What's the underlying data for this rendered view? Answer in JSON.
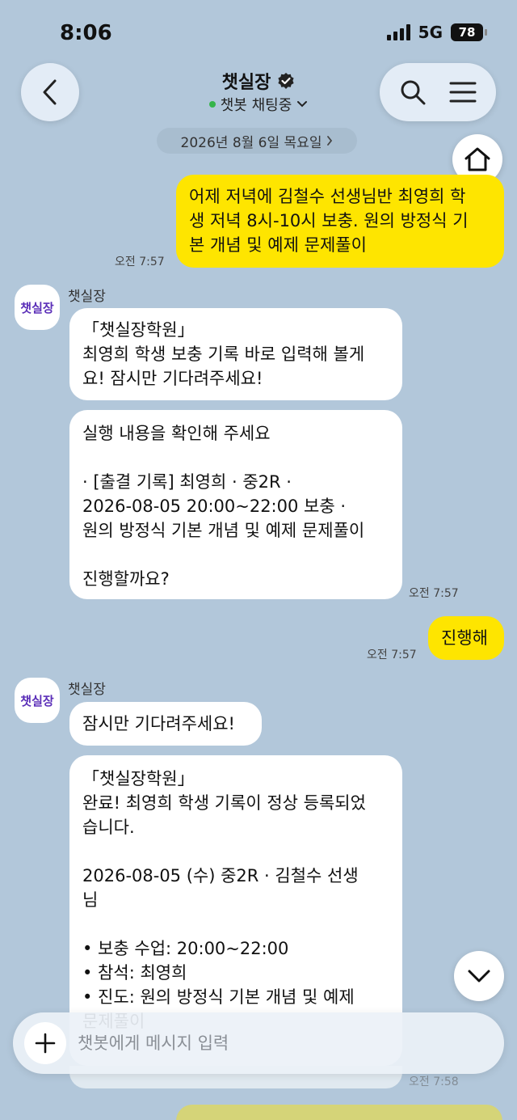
{
  "status": {
    "time": "8:06",
    "network": "5G",
    "battery": "78"
  },
  "header": {
    "title": "챗실장",
    "subtitle": "챗봇 채팅중"
  },
  "date_divider": "2026년 8월 6일 목요일",
  "messages": [
    {
      "from": "user",
      "text": "어제 저녁에 김철수 선생님반 최영희 학\n생 저녁 8시-10시 보충. 원의 방정식 기\n본 개념 및 예제 문제풀이",
      "time": "오전 7:57"
    },
    {
      "from": "bot",
      "sender": "챗실장",
      "avatar": "챗실장",
      "text": "「챗실장학원」\n최영희 학생 보충 기록 바로 입력해 볼게\n요! 잠시만 기다려주세요!"
    },
    {
      "from": "bot",
      "text": "실행 내용을 확인해 주세요\n\n· [출결 기록] 최영희 · 중2R ·\n2026-08-05 20:00~22:00 보충 ·\n원의 방정식 기본 개념 및 예제 문제풀이\n\n진행할까요?",
      "time": "오전 7:57"
    },
    {
      "from": "user",
      "text": "진행해",
      "time": "오전 7:57"
    },
    {
      "from": "bot",
      "sender": "챗실장",
      "avatar": "챗실장",
      "text": "잠시만 기다려주세요!"
    },
    {
      "from": "bot",
      "text": "「챗실장학원」\n완료! 최영희 학생 기록이 정상 등록되었\n습니다.\n\n2026-08-05 (수) 중2R · 김철수 선생\n님\n\n• 보충 수업: 20:00~22:00\n• 참석: 최영희\n• 진도: 원의 방정식 기본 개념 및 예제\n문제풀이",
      "time": "오전 7:58"
    }
  ],
  "composer": {
    "placeholder": "챗봇에게 메시지 입력"
  },
  "icons": [
    "back-arrow-icon",
    "search-icon",
    "menu-icon",
    "home-icon",
    "chevron-down-icon",
    "plus-icon",
    "verified-badge-icon"
  ],
  "colors": {
    "background": "#b2c7da",
    "user_bubble": "#fee500",
    "bot_bubble": "#ffffff",
    "online_dot": "#35b44a",
    "avatar_text": "#5b2fb8"
  }
}
